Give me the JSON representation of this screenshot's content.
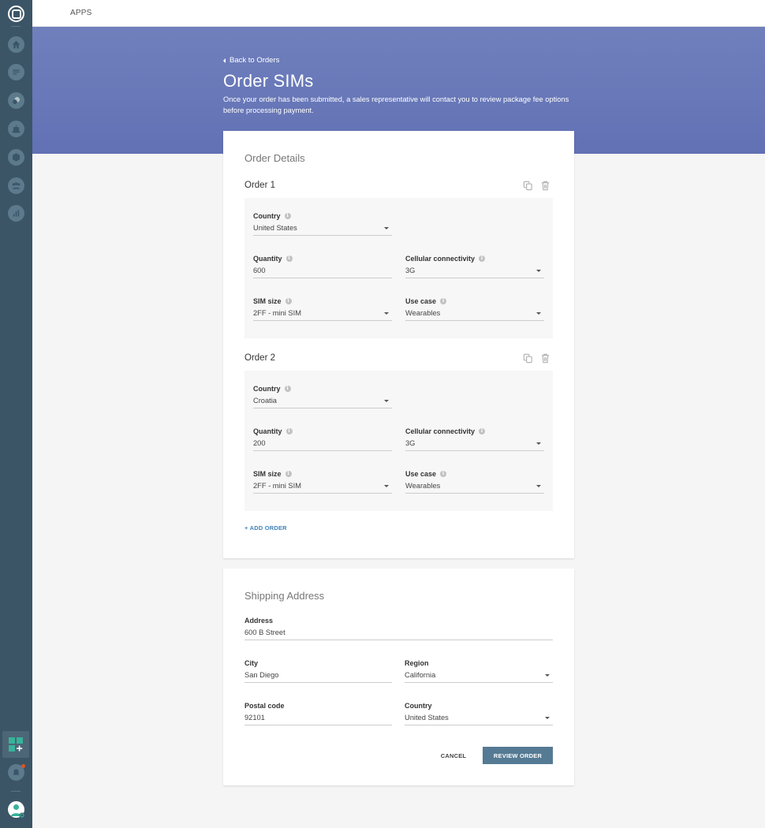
{
  "topbar": {
    "apps_label": "APPS"
  },
  "sidebar": {
    "items": [
      {
        "icon": "home-icon"
      },
      {
        "icon": "chat-bubble-icon"
      },
      {
        "icon": "conversation-icon"
      },
      {
        "icon": "robot-icon"
      },
      {
        "icon": "network-icon"
      },
      {
        "icon": "users-group-icon"
      },
      {
        "icon": "bar-chart-icon"
      }
    ],
    "bottom": {
      "apps": "apps-grid-add-icon",
      "notifications": "bell-icon",
      "profile": "user-avatar-icon"
    }
  },
  "header": {
    "back_label": "Back to Orders",
    "title": "Order SIMs",
    "description": "Once your order has been submitted, a sales representative will contact you to review package fee options before processing payment."
  },
  "colors": {
    "hero": "#6a7aba",
    "sidebar": "#3b5567",
    "primary_button": "#557a93",
    "link": "#3f82b8"
  },
  "order_details": {
    "title": "Order Details",
    "add_order_label": "+ ADD ORDER",
    "orders": [
      {
        "title": "Order 1",
        "country": {
          "label": "Country",
          "value": "United States"
        },
        "quantity": {
          "label": "Quantity",
          "value": "600"
        },
        "connectivity": {
          "label": "Cellular connectivity",
          "value": "3G"
        },
        "sim_size": {
          "label": "SIM size",
          "value": "2FF - mini SIM"
        },
        "use_case": {
          "label": "Use case",
          "value": "Wearables"
        }
      },
      {
        "title": "Order 2",
        "country": {
          "label": "Country",
          "value": "Croatia"
        },
        "quantity": {
          "label": "Quantity",
          "value": "200"
        },
        "connectivity": {
          "label": "Cellular connectivity",
          "value": "3G"
        },
        "sim_size": {
          "label": "SIM size",
          "value": "2FF - mini SIM"
        },
        "use_case": {
          "label": "Use case",
          "value": "Wearables"
        }
      }
    ]
  },
  "shipping": {
    "title": "Shipping Address",
    "address": {
      "label": "Address",
      "value": "600 B Street"
    },
    "city": {
      "label": "City",
      "value": "San Diego"
    },
    "region": {
      "label": "Region",
      "value": "California"
    },
    "postal_code": {
      "label": "Postal code",
      "value": "92101"
    },
    "country": {
      "label": "Country",
      "value": "United States"
    },
    "cancel_label": "CANCEL",
    "review_label": "REVIEW ORDER"
  }
}
